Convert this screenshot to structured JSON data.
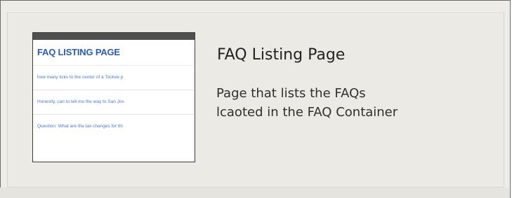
{
  "thumbnail": {
    "heading": "FAQ LISTING PAGE",
    "items": [
      "how many licks to the center of a Tootsie p",
      "Honestly, can to tell me the way to San Jos",
      "Question: What are the tax changes for thi"
    ]
  },
  "card": {
    "title": "FAQ Listing Page",
    "description_lines": [
      "Page that lists the FAQs",
      "lcaoted in the FAQ Container"
    ]
  },
  "colors": {
    "heading_blue": "#2a5db0",
    "link_blue": "#4a7cc0",
    "thumb_bar": "#505050",
    "panel_bg": "#ebeae5"
  }
}
